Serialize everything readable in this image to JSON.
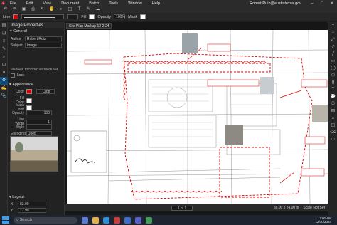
{
  "menubar": {
    "items": [
      "File",
      "Edit",
      "View",
      "Document",
      "Batch",
      "Tools",
      "Window",
      "Help"
    ],
    "user": "Robert.Ruiz@austintexas.gov"
  },
  "toolbar2": {
    "line_label": "Line",
    "fill_label": "Fill",
    "opacity_label": "Opacity",
    "opacity_value": "100%",
    "mask_label": "Mask",
    "line_color": "#dd0000"
  },
  "panel": {
    "title": "Image Properties",
    "general": "General",
    "author_label": "Author",
    "author_value": "Robert Ruiz",
    "subject_label": "Subject",
    "subject_value": "Image",
    "modified": "Modified: 12/10/2024 6:56:06 AM",
    "lock_label": "Lock",
    "appearance": "Appearance",
    "color_label": "Color",
    "crop_label": "Crop",
    "fill_color_label": "Fill Color",
    "mask_color_label": "Mask Color",
    "opacity_label": "Opacity",
    "opacity_value": "100",
    "line_width_label": "Line Width",
    "line_width_value": "1",
    "style_label": "Style",
    "encoding_label": "Encoding",
    "encoding_value": "Jpeg",
    "layout": "Layout",
    "x_label": "X",
    "x_value": "83.00",
    "y_label": "Y",
    "y_value": "77.90"
  },
  "document": {
    "tab_title": "Site Plan Markup 12-2-24"
  },
  "statusbar": {
    "page": "1 of 1",
    "dimensions": "36.00 x 24.00 in",
    "scale": "Scale Not Set"
  },
  "taskbar": {
    "search_placeholder": "Search",
    "time": "7:01 AM",
    "date": "12/10/2024"
  }
}
